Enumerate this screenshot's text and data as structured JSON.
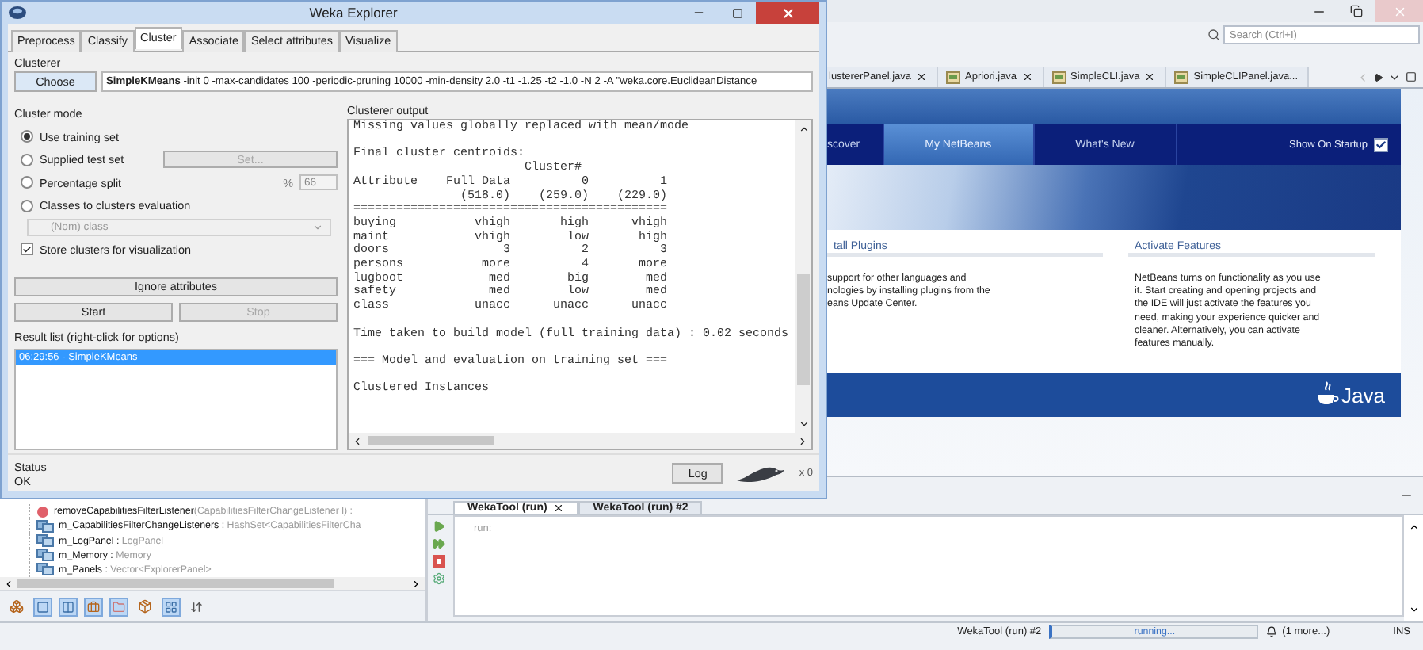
{
  "weka": {
    "title": "Weka Explorer",
    "tabs": [
      {
        "label": "Preprocess",
        "selected": false
      },
      {
        "label": "Classify",
        "selected": false
      },
      {
        "label": "Cluster",
        "selected": true
      },
      {
        "label": "Associate",
        "selected": false
      },
      {
        "label": "Select attributes",
        "selected": false
      },
      {
        "label": "Visualize",
        "selected": false
      }
    ],
    "clusterer": {
      "label": "Clusterer",
      "button": "Choose",
      "command": "**SimpleKMeans** -init 0 -max-candidates 100 -periodic-pruning 10000 -min-density 2.0 -t1 -1.25 -t2 -1.0 -N 2 -A \"weka.core.EuclideanDistance"
    },
    "cluster_mode": {
      "label": "Cluster mode",
      "options": [
        {
          "label": "Use training set",
          "selected": true
        },
        {
          "label": "Supplied test set",
          "selected": false,
          "button": {
            "label": "Set...",
            "disabled": true
          }
        },
        {
          "label": "Percentage split",
          "selected": false,
          "percent": {
            "label": "%",
            "value": "66",
            "disabled": true
          }
        },
        {
          "label": "Classes to clusters evaluation",
          "selected": false
        }
      ],
      "class_select": {
        "value": "(Nom) class",
        "disabled": true
      },
      "store_clusters": {
        "label": "Store clusters for visualization",
        "checked": true
      }
    },
    "ignore_button": "Ignore attributes",
    "start": {
      "label": "Start",
      "disabled": false
    },
    "stop": {
      "label": "Stop",
      "disabled": true
    },
    "result_list": {
      "label": "Result list (right-click for options)",
      "items": [
        {
          "label": "06:29:56 - SimpleKMeans",
          "selected": true
        }
      ]
    },
    "output": {
      "label": "Clusterer output",
      "blocks": [
        [
          "Missing values globally replaced with mean/mode"
        ],
        [
          "Final cluster centroids:",
          "                        Cluster#",
          "Attribute    Full Data          0          1",
          "               (518.0)    (259.0)    (229.0)",
          "============================================",
          "buying           vhigh       high      vhigh",
          "maint            vhigh        low       high",
          "doors                3          2          3",
          "persons           more          4       more",
          "lugboot            med        big        med",
          "safety             med        low        med",
          "class            unacc      unacc      unacc"
        ],
        [
          "Time taken to build model (full training data) : 0.02 seconds"
        ],
        [
          "=== Model and evaluation on training set ==="
        ],
        [
          "Clustered Instances"
        ]
      ]
    },
    "status": {
      "label": "Status",
      "text": "OK"
    },
    "log_button": "Log",
    "worker_count": "x 0"
  },
  "netbeans": {
    "search": {
      "placeholder": "Search (Ctrl+I)"
    },
    "editor_tabs": [
      {
        "label": "lustererPanel.java",
        "file_icon": false,
        "closable": true
      },
      {
        "label": "Apriori.java",
        "file_icon": true,
        "closable": true
      },
      {
        "label": "SimpleCLI.java",
        "file_icon": true,
        "closable": true
      },
      {
        "label": "SimpleCLIPanel.java...",
        "file_icon": true,
        "closable": false
      }
    ],
    "start_page": {
      "nav": [
        {
          "label": "scover",
          "selected": false
        },
        {
          "label": "My NetBeans",
          "selected": true
        },
        {
          "label": "What's New",
          "selected": false
        }
      ],
      "show_on_startup": {
        "label": "Show On Startup",
        "checked": true
      },
      "sections": [
        {
          "title": "tall Plugins",
          "lines": [
            "support for other languages and",
            "nologies by installing plugins from the",
            "eans Update Center."
          ]
        },
        {
          "title": "Activate Features",
          "lines": [
            "NetBeans turns on functionality as you use",
            "it. Start creating and opening projects and",
            "the IDE will just activate the features you",
            "need, making your experience quicker and",
            "cleaner. Alternatively, you can activate",
            "features manually."
          ]
        }
      ],
      "logo_text": "Java"
    },
    "navigator": {
      "items": [
        {
          "kind": "method",
          "name": "removeCapabilitiesFilterListener",
          "type": "(CapabilitiesFilterChangeListener l) :"
        },
        {
          "kind": "field",
          "name": "m_CapabilitiesFilterChangeListeners : ",
          "type": "HashSet<CapabilitiesFilterCha"
        },
        {
          "kind": "field",
          "name": "m_LogPanel : ",
          "type": "LogPanel"
        },
        {
          "kind": "field",
          "name": "m_Memory : ",
          "type": "Memory"
        },
        {
          "kind": "field",
          "name": "m_Panels : ",
          "type": "Vector<ExplorerPanel>"
        }
      ]
    },
    "output": {
      "tabs": [
        {
          "label": "WekaTool (run)",
          "selected": true,
          "closable": true
        },
        {
          "label": "WekaTool (run) #2",
          "selected": false,
          "closable": false
        }
      ],
      "lines": [
        "run:"
      ]
    },
    "status_bar": {
      "task": "WekaTool (run) #2",
      "progress": "running...",
      "more": "(1 more...)",
      "mode": "INS"
    }
  }
}
